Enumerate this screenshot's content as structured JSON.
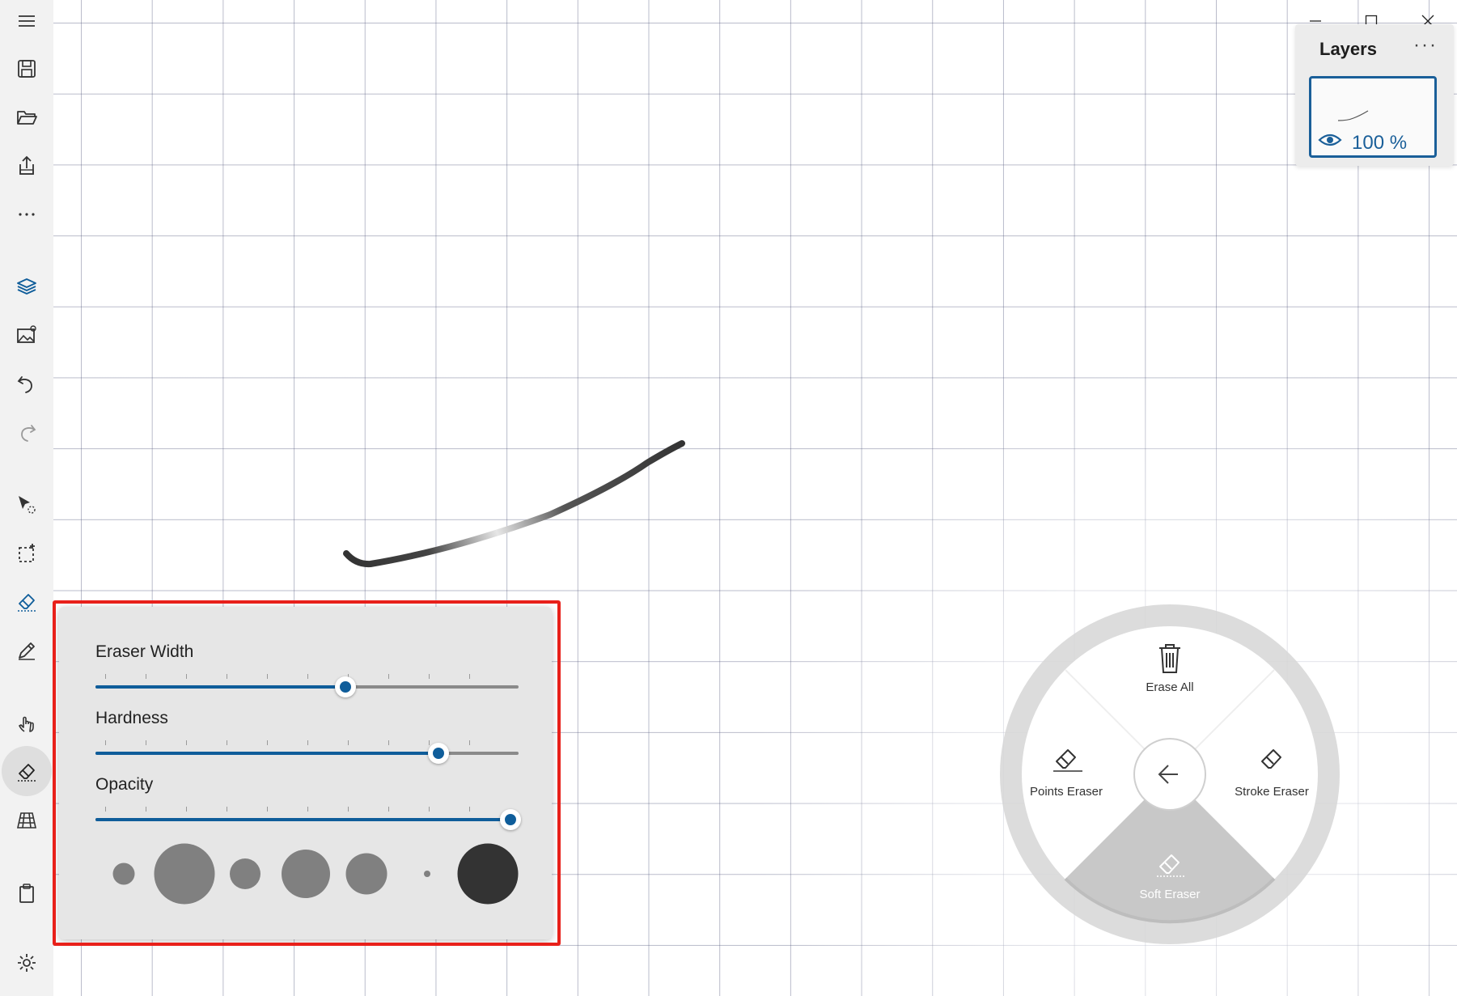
{
  "toolbar": {
    "items": [
      {
        "name": "menu-icon"
      },
      {
        "name": "save-icon"
      },
      {
        "name": "open-folder-icon"
      },
      {
        "name": "share-icon"
      },
      {
        "name": "more-icon"
      },
      {
        "name": "layers-icon"
      },
      {
        "name": "insert-image-icon"
      },
      {
        "name": "undo-icon"
      },
      {
        "name": "redo-icon"
      },
      {
        "name": "select-transform-icon"
      },
      {
        "name": "selection-icon"
      },
      {
        "name": "eraser-icon"
      },
      {
        "name": "pen-icon"
      },
      {
        "name": "touch-draw-icon"
      },
      {
        "name": "eraser-active-icon"
      },
      {
        "name": "perspective-grid-icon"
      },
      {
        "name": "clipboard-icon"
      },
      {
        "name": "settings-icon"
      }
    ]
  },
  "window": {
    "controls": [
      "minimize-icon",
      "maximize-icon",
      "close-icon"
    ]
  },
  "layers": {
    "title": "Layers",
    "more": "···",
    "opacity": "100 %"
  },
  "eraser_panel": {
    "width_label": "Eraser Width",
    "width_value": 0.59,
    "hardness_label": "Hardness",
    "hardness_value": 0.81,
    "opacity_label": "Opacity",
    "opacity_value": 0.98
  },
  "radial_menu": {
    "erase_all": "Erase All",
    "points_eraser": "Points Eraser",
    "stroke_eraser": "Stroke Eraser",
    "soft_eraser": "Soft Eraser"
  },
  "colors": {
    "accent": "#0f5d9a",
    "highlight": "#e8201a",
    "stroke": "#333333"
  }
}
